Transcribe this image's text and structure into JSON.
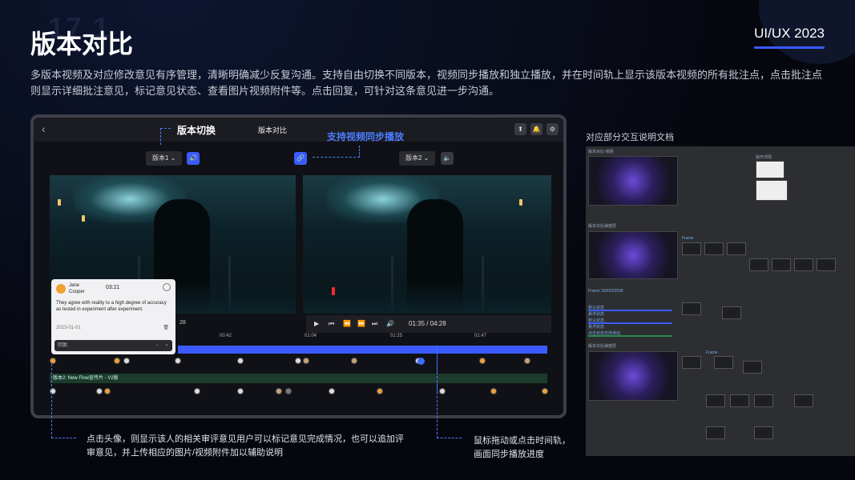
{
  "page": {
    "section_number": "17.1",
    "title": "版本对比",
    "brand": "UI/UX 2023",
    "description": "多版本视频及对应修改意见有序管理，清晰明确减少反复沟通。支持自由切换不同版本，视频同步播放和独立播放，并在时间轨上显示该版本视频的所有批注点，点击批注点则显示详细批注意见，标记意见状态、查看图片视频附件等。点击回复，可针对这条意见进一步沟通。"
  },
  "app": {
    "back_icon": "chevron-left-icon",
    "screen_title": "版本对比",
    "left_version": "版本1",
    "right_version": "版本2",
    "time_left": "28",
    "time_right": "01:35 / 04:28",
    "ruler": [
      "00:42",
      "01:04",
      "01:25",
      "01:47"
    ],
    "track_label": "版本2: New Flow宣传片 - V2版"
  },
  "comment": {
    "name_line1": "Jane",
    "name_line2": "Cooper",
    "time": "03:21",
    "body": "They agree with reality to a high degree of accuracy as tested in experiment after experiment.",
    "date": "2023-01-01",
    "reply_placeholder": "回复:"
  },
  "annotations": {
    "version_switch": "版本切换",
    "sync_play": "支持视频同步播放",
    "click_avatar": "点击头像，则显示该人的相关审评意见用户可以标记意见完成情况，也可以追加评审意见，并上传相应的图片/视频附件加以辅助说明",
    "drag_timeline_1": "鼠标拖动或点击时间轨，",
    "drag_timeline_2": "画面同步播放进度"
  },
  "doc": {
    "title": "对应部分交互说明文档",
    "labels": [
      "版本对比-视频",
      "版本对比弹窗层",
      "版本对比弹窗层",
      "Frame 1000003558",
      "默认状态",
      "悬浮状态",
      "默认状态",
      "悬浮状态",
      "点击状态支持滑动",
      "操作详情",
      "Frame",
      "Frame"
    ]
  },
  "colors": {
    "accent": "#3b5bff",
    "annotation_blue": "#4b7dff"
  }
}
